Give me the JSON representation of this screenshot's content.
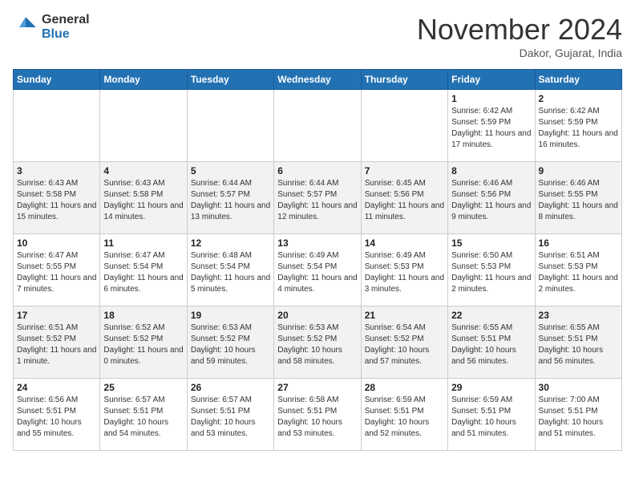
{
  "header": {
    "logo_general": "General",
    "logo_blue": "Blue",
    "month_title": "November 2024",
    "subtitle": "Dakor, Gujarat, India"
  },
  "weekdays": [
    "Sunday",
    "Monday",
    "Tuesday",
    "Wednesday",
    "Thursday",
    "Friday",
    "Saturday"
  ],
  "weeks": [
    [
      {
        "day": "",
        "info": ""
      },
      {
        "day": "",
        "info": ""
      },
      {
        "day": "",
        "info": ""
      },
      {
        "day": "",
        "info": ""
      },
      {
        "day": "",
        "info": ""
      },
      {
        "day": "1",
        "info": "Sunrise: 6:42 AM\nSunset: 5:59 PM\nDaylight: 11 hours and 17 minutes."
      },
      {
        "day": "2",
        "info": "Sunrise: 6:42 AM\nSunset: 5:59 PM\nDaylight: 11 hours and 16 minutes."
      }
    ],
    [
      {
        "day": "3",
        "info": "Sunrise: 6:43 AM\nSunset: 5:58 PM\nDaylight: 11 hours and 15 minutes."
      },
      {
        "day": "4",
        "info": "Sunrise: 6:43 AM\nSunset: 5:58 PM\nDaylight: 11 hours and 14 minutes."
      },
      {
        "day": "5",
        "info": "Sunrise: 6:44 AM\nSunset: 5:57 PM\nDaylight: 11 hours and 13 minutes."
      },
      {
        "day": "6",
        "info": "Sunrise: 6:44 AM\nSunset: 5:57 PM\nDaylight: 11 hours and 12 minutes."
      },
      {
        "day": "7",
        "info": "Sunrise: 6:45 AM\nSunset: 5:56 PM\nDaylight: 11 hours and 11 minutes."
      },
      {
        "day": "8",
        "info": "Sunrise: 6:46 AM\nSunset: 5:56 PM\nDaylight: 11 hours and 9 minutes."
      },
      {
        "day": "9",
        "info": "Sunrise: 6:46 AM\nSunset: 5:55 PM\nDaylight: 11 hours and 8 minutes."
      }
    ],
    [
      {
        "day": "10",
        "info": "Sunrise: 6:47 AM\nSunset: 5:55 PM\nDaylight: 11 hours and 7 minutes."
      },
      {
        "day": "11",
        "info": "Sunrise: 6:47 AM\nSunset: 5:54 PM\nDaylight: 11 hours and 6 minutes."
      },
      {
        "day": "12",
        "info": "Sunrise: 6:48 AM\nSunset: 5:54 PM\nDaylight: 11 hours and 5 minutes."
      },
      {
        "day": "13",
        "info": "Sunrise: 6:49 AM\nSunset: 5:54 PM\nDaylight: 11 hours and 4 minutes."
      },
      {
        "day": "14",
        "info": "Sunrise: 6:49 AM\nSunset: 5:53 PM\nDaylight: 11 hours and 3 minutes."
      },
      {
        "day": "15",
        "info": "Sunrise: 6:50 AM\nSunset: 5:53 PM\nDaylight: 11 hours and 2 minutes."
      },
      {
        "day": "16",
        "info": "Sunrise: 6:51 AM\nSunset: 5:53 PM\nDaylight: 11 hours and 2 minutes."
      }
    ],
    [
      {
        "day": "17",
        "info": "Sunrise: 6:51 AM\nSunset: 5:52 PM\nDaylight: 11 hours and 1 minute."
      },
      {
        "day": "18",
        "info": "Sunrise: 6:52 AM\nSunset: 5:52 PM\nDaylight: 11 hours and 0 minutes."
      },
      {
        "day": "19",
        "info": "Sunrise: 6:53 AM\nSunset: 5:52 PM\nDaylight: 10 hours and 59 minutes."
      },
      {
        "day": "20",
        "info": "Sunrise: 6:53 AM\nSunset: 5:52 PM\nDaylight: 10 hours and 58 minutes."
      },
      {
        "day": "21",
        "info": "Sunrise: 6:54 AM\nSunset: 5:52 PM\nDaylight: 10 hours and 57 minutes."
      },
      {
        "day": "22",
        "info": "Sunrise: 6:55 AM\nSunset: 5:51 PM\nDaylight: 10 hours and 56 minutes."
      },
      {
        "day": "23",
        "info": "Sunrise: 6:55 AM\nSunset: 5:51 PM\nDaylight: 10 hours and 56 minutes."
      }
    ],
    [
      {
        "day": "24",
        "info": "Sunrise: 6:56 AM\nSunset: 5:51 PM\nDaylight: 10 hours and 55 minutes."
      },
      {
        "day": "25",
        "info": "Sunrise: 6:57 AM\nSunset: 5:51 PM\nDaylight: 10 hours and 54 minutes."
      },
      {
        "day": "26",
        "info": "Sunrise: 6:57 AM\nSunset: 5:51 PM\nDaylight: 10 hours and 53 minutes."
      },
      {
        "day": "27",
        "info": "Sunrise: 6:58 AM\nSunset: 5:51 PM\nDaylight: 10 hours and 53 minutes."
      },
      {
        "day": "28",
        "info": "Sunrise: 6:59 AM\nSunset: 5:51 PM\nDaylight: 10 hours and 52 minutes."
      },
      {
        "day": "29",
        "info": "Sunrise: 6:59 AM\nSunset: 5:51 PM\nDaylight: 10 hours and 51 minutes."
      },
      {
        "day": "30",
        "info": "Sunrise: 7:00 AM\nSunset: 5:51 PM\nDaylight: 10 hours and 51 minutes."
      }
    ]
  ]
}
